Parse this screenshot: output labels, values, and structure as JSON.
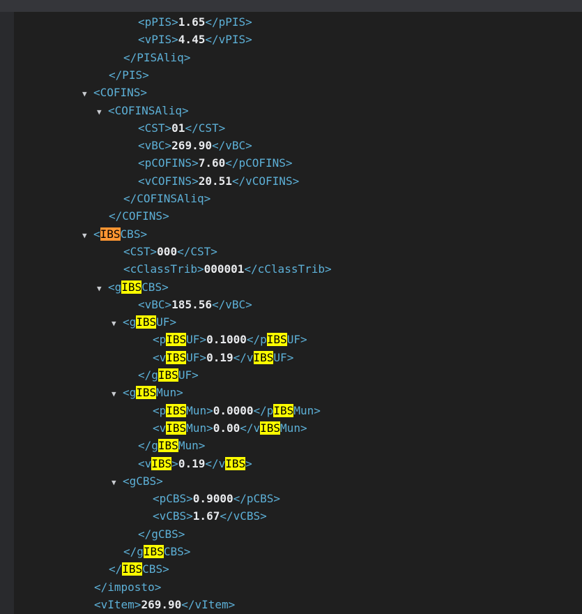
{
  "colors": {
    "background": "#1f1f1f",
    "tag": "#5db0d7",
    "value": "#e8eaed",
    "match_highlight": "#ffff00",
    "active_match_highlight": "#ff9632"
  },
  "search": {
    "term": "IBS"
  },
  "lines": [
    {
      "indent": 4,
      "expander": false,
      "segments": [
        {
          "t": "<pPIS>",
          "k": "tag"
        },
        {
          "t": "1.65",
          "k": "val"
        },
        {
          "t": "</pPIS>",
          "k": "tag"
        }
      ]
    },
    {
      "indent": 4,
      "expander": false,
      "segments": [
        {
          "t": "<vPIS>",
          "k": "tag"
        },
        {
          "t": "4.45",
          "k": "val"
        },
        {
          "t": "</vPIS>",
          "k": "tag"
        }
      ]
    },
    {
      "indent": 3,
      "expander": false,
      "segments": [
        {
          "t": "</PISAliq>",
          "k": "tag"
        }
      ]
    },
    {
      "indent": 2,
      "expander": false,
      "segments": [
        {
          "t": "</PIS>",
          "k": "tag"
        }
      ]
    },
    {
      "indent": 1,
      "expander": true,
      "segments": [
        {
          "t": "<COFINS>",
          "k": "tag"
        }
      ]
    },
    {
      "indent": 2,
      "expander": true,
      "segments": [
        {
          "t": "<COFINSAliq>",
          "k": "tag"
        }
      ]
    },
    {
      "indent": 4,
      "expander": false,
      "segments": [
        {
          "t": "<CST>",
          "k": "tag"
        },
        {
          "t": "01",
          "k": "val"
        },
        {
          "t": "</CST>",
          "k": "tag"
        }
      ]
    },
    {
      "indent": 4,
      "expander": false,
      "segments": [
        {
          "t": "<vBC>",
          "k": "tag"
        },
        {
          "t": "269.90",
          "k": "val"
        },
        {
          "t": "</vBC>",
          "k": "tag"
        }
      ]
    },
    {
      "indent": 4,
      "expander": false,
      "segments": [
        {
          "t": "<pCOFINS>",
          "k": "tag"
        },
        {
          "t": "7.60",
          "k": "val"
        },
        {
          "t": "</pCOFINS>",
          "k": "tag"
        }
      ]
    },
    {
      "indent": 4,
      "expander": false,
      "segments": [
        {
          "t": "<vCOFINS>",
          "k": "tag"
        },
        {
          "t": "20.51",
          "k": "val"
        },
        {
          "t": "</vCOFINS>",
          "k": "tag"
        }
      ]
    },
    {
      "indent": 3,
      "expander": false,
      "segments": [
        {
          "t": "</COFINSAliq>",
          "k": "tag"
        }
      ]
    },
    {
      "indent": 2,
      "expander": false,
      "segments": [
        {
          "t": "</COFINS>",
          "k": "tag"
        }
      ]
    },
    {
      "indent": 1,
      "expander": true,
      "segments": [
        {
          "t": "<",
          "k": "tag"
        },
        {
          "t": "IBS",
          "k": "hl-active"
        },
        {
          "t": "CBS>",
          "k": "tag"
        }
      ]
    },
    {
      "indent": 3,
      "expander": false,
      "segments": [
        {
          "t": "<CST>",
          "k": "tag"
        },
        {
          "t": "000",
          "k": "val"
        },
        {
          "t": "</CST>",
          "k": "tag"
        }
      ]
    },
    {
      "indent": 3,
      "expander": false,
      "segments": [
        {
          "t": "<cClassTrib>",
          "k": "tag"
        },
        {
          "t": "000001",
          "k": "val"
        },
        {
          "t": "</cClassTrib>",
          "k": "tag"
        }
      ]
    },
    {
      "indent": 2,
      "expander": true,
      "segments": [
        {
          "t": "<g",
          "k": "tag"
        },
        {
          "t": "IBS",
          "k": "hl"
        },
        {
          "t": "CBS>",
          "k": "tag"
        }
      ]
    },
    {
      "indent": 4,
      "expander": false,
      "segments": [
        {
          "t": "<vBC>",
          "k": "tag"
        },
        {
          "t": "185.56",
          "k": "val"
        },
        {
          "t": "</vBC>",
          "k": "tag"
        }
      ]
    },
    {
      "indent": 3,
      "expander": true,
      "segments": [
        {
          "t": "<g",
          "k": "tag"
        },
        {
          "t": "IBS",
          "k": "hl"
        },
        {
          "t": "UF>",
          "k": "tag"
        }
      ]
    },
    {
      "indent": 5,
      "expander": false,
      "segments": [
        {
          "t": "<p",
          "k": "tag"
        },
        {
          "t": "IBS",
          "k": "hl"
        },
        {
          "t": "UF>",
          "k": "tag"
        },
        {
          "t": "0.1000",
          "k": "val"
        },
        {
          "t": "</p",
          "k": "tag"
        },
        {
          "t": "IBS",
          "k": "hl"
        },
        {
          "t": "UF>",
          "k": "tag"
        }
      ]
    },
    {
      "indent": 5,
      "expander": false,
      "segments": [
        {
          "t": "<v",
          "k": "tag"
        },
        {
          "t": "IBS",
          "k": "hl"
        },
        {
          "t": "UF>",
          "k": "tag"
        },
        {
          "t": "0.19",
          "k": "val"
        },
        {
          "t": "</v",
          "k": "tag"
        },
        {
          "t": "IBS",
          "k": "hl"
        },
        {
          "t": "UF>",
          "k": "tag"
        }
      ]
    },
    {
      "indent": 4,
      "expander": false,
      "segments": [
        {
          "t": "</g",
          "k": "tag"
        },
        {
          "t": "IBS",
          "k": "hl"
        },
        {
          "t": "UF>",
          "k": "tag"
        }
      ]
    },
    {
      "indent": 3,
      "expander": true,
      "segments": [
        {
          "t": "<g",
          "k": "tag"
        },
        {
          "t": "IBS",
          "k": "hl"
        },
        {
          "t": "Mun>",
          "k": "tag"
        }
      ]
    },
    {
      "indent": 5,
      "expander": false,
      "segments": [
        {
          "t": "<p",
          "k": "tag"
        },
        {
          "t": "IBS",
          "k": "hl"
        },
        {
          "t": "Mun>",
          "k": "tag"
        },
        {
          "t": "0.0000",
          "k": "val"
        },
        {
          "t": "</p",
          "k": "tag"
        },
        {
          "t": "IBS",
          "k": "hl"
        },
        {
          "t": "Mun>",
          "k": "tag"
        }
      ]
    },
    {
      "indent": 5,
      "expander": false,
      "segments": [
        {
          "t": "<v",
          "k": "tag"
        },
        {
          "t": "IBS",
          "k": "hl"
        },
        {
          "t": "Mun>",
          "k": "tag"
        },
        {
          "t": "0.00",
          "k": "val"
        },
        {
          "t": "</v",
          "k": "tag"
        },
        {
          "t": "IBS",
          "k": "hl"
        },
        {
          "t": "Mun>",
          "k": "tag"
        }
      ]
    },
    {
      "indent": 4,
      "expander": false,
      "segments": [
        {
          "t": "</g",
          "k": "tag"
        },
        {
          "t": "IBS",
          "k": "hl"
        },
        {
          "t": "Mun>",
          "k": "tag"
        }
      ]
    },
    {
      "indent": 4,
      "expander": false,
      "segments": [
        {
          "t": "<v",
          "k": "tag"
        },
        {
          "t": "IBS",
          "k": "hl"
        },
        {
          "t": ">",
          "k": "tag"
        },
        {
          "t": "0.19",
          "k": "val"
        },
        {
          "t": "</v",
          "k": "tag"
        },
        {
          "t": "IBS",
          "k": "hl"
        },
        {
          "t": ">",
          "k": "tag"
        }
      ]
    },
    {
      "indent": 3,
      "expander": true,
      "segments": [
        {
          "t": "<gCBS>",
          "k": "tag"
        }
      ]
    },
    {
      "indent": 5,
      "expander": false,
      "segments": [
        {
          "t": "<pCBS>",
          "k": "tag"
        },
        {
          "t": "0.9000",
          "k": "val"
        },
        {
          "t": "</pCBS>",
          "k": "tag"
        }
      ]
    },
    {
      "indent": 5,
      "expander": false,
      "segments": [
        {
          "t": "<vCBS>",
          "k": "tag"
        },
        {
          "t": "1.67",
          "k": "val"
        },
        {
          "t": "</vCBS>",
          "k": "tag"
        }
      ]
    },
    {
      "indent": 4,
      "expander": false,
      "segments": [
        {
          "t": "</gCBS>",
          "k": "tag"
        }
      ]
    },
    {
      "indent": 3,
      "expander": false,
      "segments": [
        {
          "t": "</g",
          "k": "tag"
        },
        {
          "t": "IBS",
          "k": "hl"
        },
        {
          "t": "CBS>",
          "k": "tag"
        }
      ]
    },
    {
      "indent": 2,
      "expander": false,
      "segments": [
        {
          "t": "</",
          "k": "tag"
        },
        {
          "t": "IBS",
          "k": "hl"
        },
        {
          "t": "CBS>",
          "k": "tag"
        }
      ]
    },
    {
      "indent": 1,
      "expander": false,
      "segments": [
        {
          "t": "</imposto>",
          "k": "tag"
        }
      ]
    },
    {
      "indent": 1,
      "expander": false,
      "segments": [
        {
          "t": "<vItem>",
          "k": "tag"
        },
        {
          "t": "269.90",
          "k": "val"
        },
        {
          "t": "</vItem>",
          "k": "tag"
        }
      ]
    }
  ]
}
